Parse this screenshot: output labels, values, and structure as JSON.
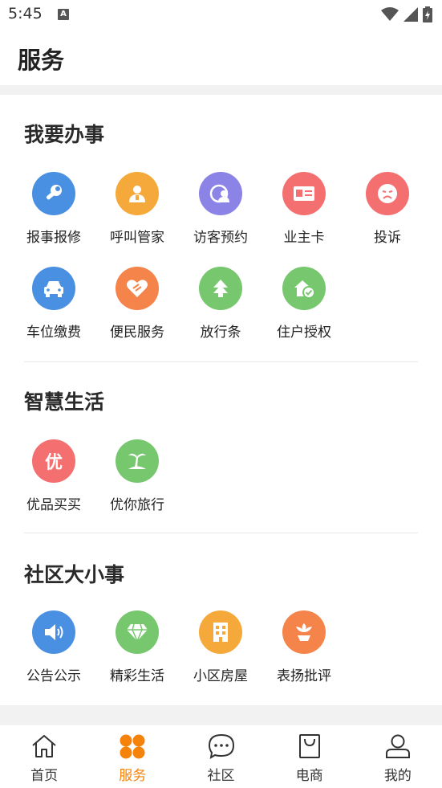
{
  "status": {
    "time": "5:45",
    "notification_badge": "A"
  },
  "header": {
    "title": "服务"
  },
  "sections": [
    {
      "title": "我要办事",
      "items": [
        {
          "label": "报事报修",
          "icon": "wrench-icon",
          "color": "#4a90e2"
        },
        {
          "label": "呼叫管家",
          "icon": "butler-icon",
          "color": "#f5a93a"
        },
        {
          "label": "访客预约",
          "icon": "visitor-icon",
          "color": "#8b84e6"
        },
        {
          "label": "业主卡",
          "icon": "id-card-icon",
          "color": "#f47070"
        },
        {
          "label": "投诉",
          "icon": "complaint-face-icon",
          "color": "#f47070"
        },
        {
          "label": "车位缴费",
          "icon": "car-icon",
          "color": "#4a90e2"
        },
        {
          "label": "便民服务",
          "icon": "heart-hand-icon",
          "color": "#f4844a"
        },
        {
          "label": "放行条",
          "icon": "release-pass-icon",
          "color": "#77c76e"
        },
        {
          "label": "住户授权",
          "icon": "house-check-icon",
          "color": "#77c76e"
        }
      ]
    },
    {
      "title": "智慧生活",
      "items": [
        {
          "label": "优品买买",
          "icon": "you-badge-icon",
          "glyph": "优",
          "color": "#f47070"
        },
        {
          "label": "优你旅行",
          "icon": "palm-island-icon",
          "color": "#77c76e"
        }
      ]
    },
    {
      "title": "社区大小事",
      "items": [
        {
          "label": "公告公示",
          "icon": "speaker-icon",
          "color": "#4a90e2"
        },
        {
          "label": "精彩生活",
          "icon": "diamond-icon",
          "color": "#77c76e"
        },
        {
          "label": "小区房屋",
          "icon": "building-icon",
          "color": "#f5a93a"
        },
        {
          "label": "表扬批评",
          "icon": "flower-icon",
          "color": "#f4844a"
        }
      ]
    }
  ],
  "tabs": [
    {
      "label": "首页",
      "icon": "home-icon",
      "active": false
    },
    {
      "label": "服务",
      "icon": "service-grid-icon",
      "active": true
    },
    {
      "label": "社区",
      "icon": "chat-bubble-icon",
      "active": false
    },
    {
      "label": "电商",
      "icon": "shopping-bag-icon",
      "active": false
    },
    {
      "label": "我的",
      "icon": "user-icon",
      "active": false
    }
  ],
  "colors": {
    "accent": "#f5820a"
  }
}
